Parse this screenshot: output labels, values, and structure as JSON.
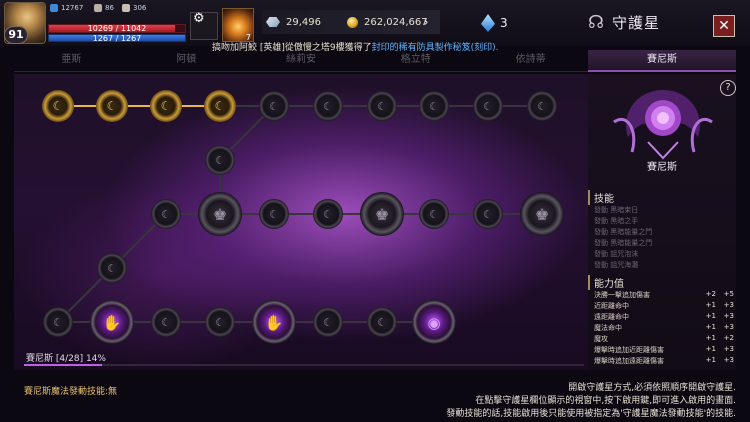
{
  "player": {
    "level": "91",
    "combat_power": "12767",
    "stat_a": "86",
    "stat_b": "306",
    "hp_text": "10269 / 11042",
    "hp_ratio": 0.93,
    "mp_text": "1267 / 1267",
    "mp_ratio": 1.0
  },
  "hud": {
    "potion_count": "7",
    "diamond_amount": "29,496",
    "gold_amount": "262,024,667",
    "gem_count": "3",
    "window_title": "守護星",
    "close_symbol": "✕",
    "gear_glyph": "⚙",
    "arrow_glyph": "›",
    "title_icon_glyph": "☊"
  },
  "announcement": {
    "prefix": "搞吻加阿鮫 ",
    "middle": "[英雄]從傲慢之塔9樓獲得了",
    "highlight": "封印的稀有防具製作秘笈(刻印).",
    "colors": {
      "highlight": "#5fb6ff"
    }
  },
  "tabs": [
    "亜斯",
    "阿頓",
    "絲莉安",
    "格立特",
    "依詩蒂"
  ],
  "active_tab": "賽尼斯",
  "board": {
    "progress_label": "賽尼斯 [4/28] 14%",
    "activated": 4,
    "total": 28,
    "progress_ratio": 0.14
  },
  "side": {
    "help_glyph": "?",
    "guardian_name": "賽尼斯",
    "skills_title": "技能",
    "skills": [
      "發動 黑暗束日",
      "發動 黑暗之手",
      "發動 黑暗能量之門",
      "發動 黑暗能量之門",
      "發動 詛咒泡沫",
      "發動 詛咒海灘"
    ],
    "stats_title": "能力值",
    "stats": [
      {
        "name": "決勝一擊追加傷害",
        "a": "+2",
        "b": "+5"
      },
      {
        "name": "近距離命中",
        "a": "+1",
        "b": "+3"
      },
      {
        "name": "遠距離命中",
        "a": "+1",
        "b": "+3"
      },
      {
        "name": "魔法命中",
        "a": "+1",
        "b": "+3"
      },
      {
        "name": "魔攻",
        "a": "+1",
        "b": "+2"
      },
      {
        "name": "爆擊時追加近距離傷害",
        "a": "+1",
        "b": "+3"
      },
      {
        "name": "爆擊時追加遠距離傷害",
        "a": "+1",
        "b": "+3"
      }
    ]
  },
  "footer": {
    "left": "賽尼斯魔法發動技能:無",
    "lines": [
      "開啟守護星方式,必須依照順序開啟守護星.",
      "在點擊守護星欄位顯示的視窗中,按下啟用鍵,即可進入啟用的畫面.",
      "發動技能的話,技能啟用後只能使用被指定為'守護星魔法發動技能'的技能."
    ]
  },
  "colors": {
    "accent_purple": "#c060e0",
    "gold_node": "#e8b84a",
    "close_red": "#7a1e20"
  }
}
